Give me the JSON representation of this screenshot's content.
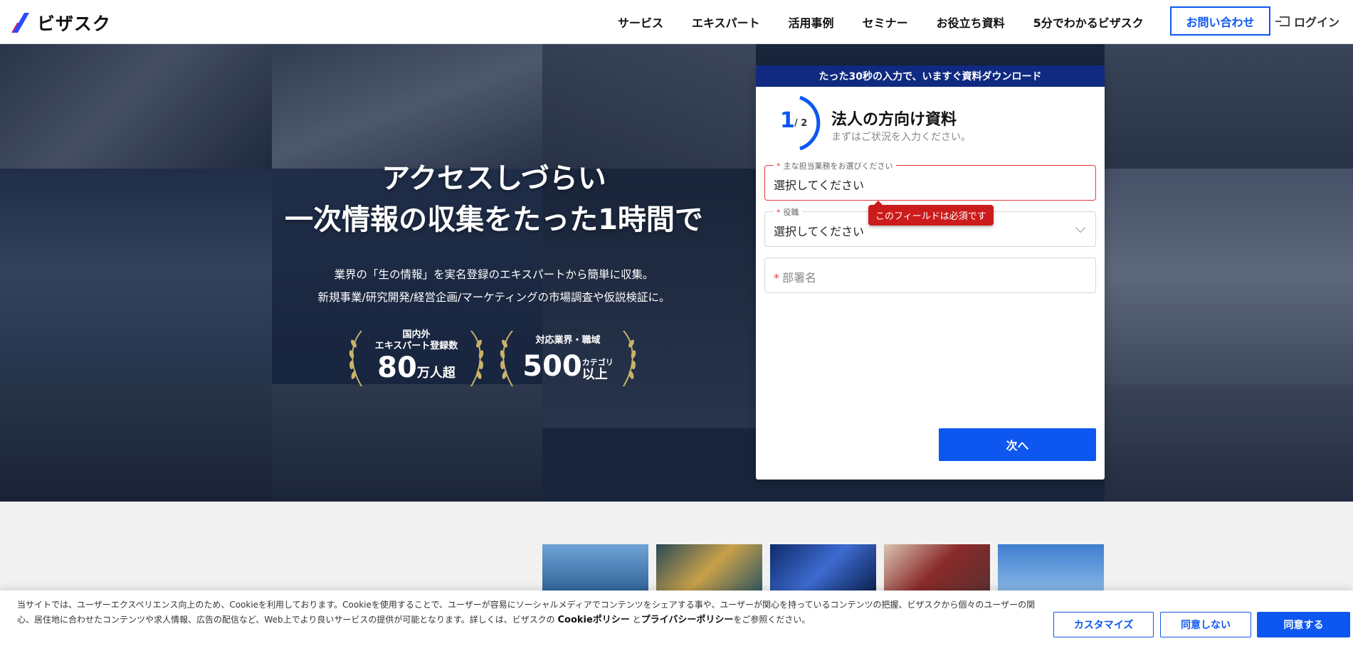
{
  "header": {
    "logo_text": "ビザスク",
    "nav": [
      "サービス",
      "エキスパート",
      "活用事例",
      "セミナー",
      "お役立ち資料",
      "5分でわかるビザスク"
    ],
    "contact_label": "お問い合わせ",
    "login_label": "ログイン"
  },
  "hero": {
    "title_line1": "アクセスしづらい",
    "title_line2": "一次情報の収集をたった1時間で",
    "sub_line1": "業界の「生の情報」を実名登録のエキスパートから簡単に収集。",
    "sub_line2": "新規事業/研究開発/経営企画/マーケティングの市場調査や仮説検証に。",
    "badge1": {
      "label_line1": "国内外",
      "label_line2": "エキスパート登録数",
      "number": "80",
      "unit": "万人超"
    },
    "badge2": {
      "label": "対応業界・職域",
      "number": "500",
      "unit_line1": "カテゴリ",
      "unit_line2": "以上"
    }
  },
  "form": {
    "banner": "たった30秒の入力で、いますぐ資料ダウンロード",
    "step_current": "1",
    "step_total": "/ 2",
    "title": "法人の方向け資料",
    "subtitle": "まずはご状況を入力ください。",
    "field1_label": "主な担当業務をお選びください",
    "field1_value": "選択してください",
    "field2_label": "役職",
    "field2_value": "選択してください",
    "field3_placeholder": "部署名",
    "required_mark": "*",
    "error_tooltip": "このフィールドは必須です",
    "next_label": "次へ"
  },
  "cookie": {
    "text_line1": "当サイトでは、ユーザーエクスペリエンス向上のため、Cookieを利用しております。Cookieを使用することで、ユーザーが容易にソーシャルメディアでコンテンツをシェアする事や、ユーザーが関心を持っているコンテンツの把握、ビザスクから個々のユーザーの関",
    "text_line2_a": "心、居住地に合わせたコンテンツや求人情報、広告の配信など、Web上でより良いサービスの提供が可能となります。詳しくは、ビザスクの ",
    "cookie_policy": "Cookieポリシー",
    "text_and": " と",
    "privacy_policy": "プライバシーポリシー",
    "text_end": "をご参照ください。",
    "customize_label": "カスタマイズ",
    "decline_label": "同意しない",
    "accept_label": "同意する"
  },
  "colors": {
    "brand_blue": "#0d57f0",
    "banner_navy": "#0f2a80",
    "error_red": "#cc1b1b"
  }
}
